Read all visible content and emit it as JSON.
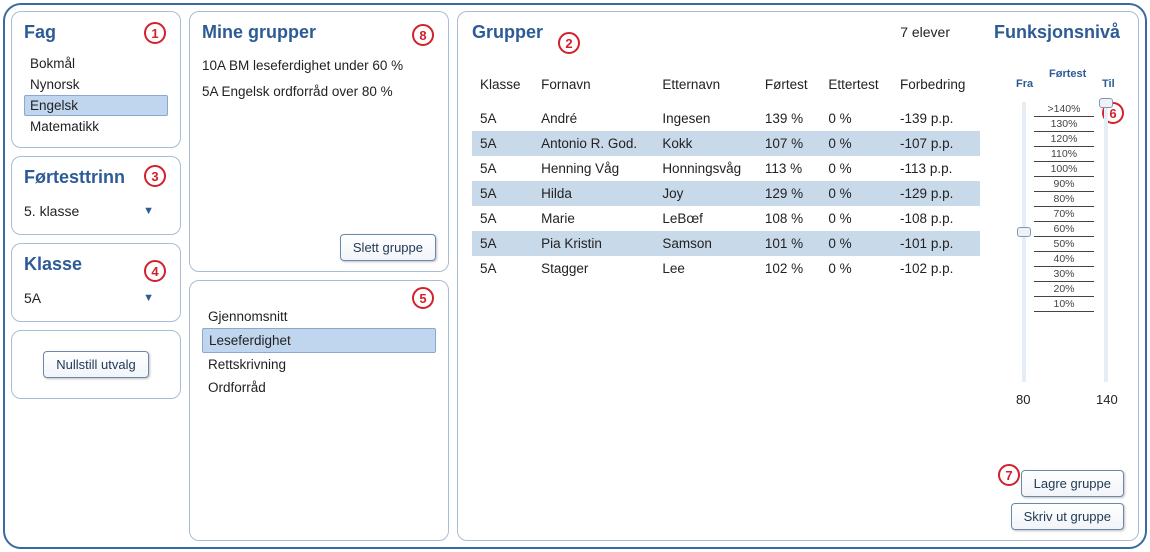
{
  "fag": {
    "title": "Fag",
    "items": [
      "Bokmål",
      "Nynorsk",
      "Engelsk",
      "Matematikk"
    ],
    "selected": 2,
    "badge": "1"
  },
  "fortesttrinn": {
    "title": "Førtesttrinn",
    "value": "5. klasse",
    "badge": "3"
  },
  "klasse": {
    "title": "Klasse",
    "value": "5A",
    "badge": "4"
  },
  "reset": {
    "label": "Nullstill utvalg"
  },
  "minegrupper": {
    "title": "Mine grupper",
    "items": [
      "10A BM leseferdighet under 60 %",
      "5A Engelsk ordforråd over 80 %"
    ],
    "delete_label": "Slett gruppe",
    "badge": "8"
  },
  "categories": {
    "items": [
      "Gjennomsnitt",
      "Leseferdighet",
      "Rettskrivning",
      "Ordforråd"
    ],
    "selected": 1,
    "badge": "5"
  },
  "grupper": {
    "title": "Grupper",
    "count_label": "7 elever",
    "badge": "2",
    "columns": [
      "Klasse",
      "Fornavn",
      "Etternavn",
      "Førtest",
      "Ettertest",
      "Forbedring"
    ],
    "rows": [
      {
        "klasse": "5A",
        "fornavn": "André",
        "etternavn": "Ingesen",
        "fortest": "139 %",
        "ettertest": "0 %",
        "forbedring": "-139 p.p."
      },
      {
        "klasse": "5A",
        "fornavn": "Antonio R. God.",
        "etternavn": "Kokk",
        "fortest": "107 %",
        "ettertest": "0 %",
        "forbedring": "-107 p.p."
      },
      {
        "klasse": "5A",
        "fornavn": "Henning Våg",
        "etternavn": "Honningsvåg",
        "fortest": "113 %",
        "ettertest": "0 %",
        "forbedring": "-113 p.p."
      },
      {
        "klasse": "5A",
        "fornavn": "Hilda",
        "etternavn": "Joy",
        "fortest": "129 %",
        "ettertest": "0 %",
        "forbedring": "-129 p.p."
      },
      {
        "klasse": "5A",
        "fornavn": "Marie",
        "etternavn": "LeBœf",
        "fortest": "108 %",
        "ettertest": "0 %",
        "forbedring": "-108 p.p."
      },
      {
        "klasse": "5A",
        "fornavn": "Pia Kristin",
        "etternavn": "Samson",
        "fortest": "101 %",
        "ettertest": "0 %",
        "forbedring": "-101 p.p."
      },
      {
        "klasse": "5A",
        "fornavn": "Stagger",
        "etternavn": "Lee",
        "fortest": "102 %",
        "ettertest": "0 %",
        "forbedring": "-102 p.p."
      }
    ]
  },
  "funksjon": {
    "title": "Funksjonsnivå",
    "fra": "Fra",
    "til": "Til",
    "sub": "Førtest",
    "scale": [
      ">140%",
      "130%",
      "120%",
      "110%",
      "100%",
      "90%",
      "80%",
      "70%",
      "60%",
      "50%",
      "40%",
      "30%",
      "20%",
      "10%"
    ],
    "min": "80",
    "max": "140",
    "badge": "6"
  },
  "actions": {
    "save": "Lagre gruppe",
    "print": "Skriv ut gruppe",
    "badge": "7"
  }
}
